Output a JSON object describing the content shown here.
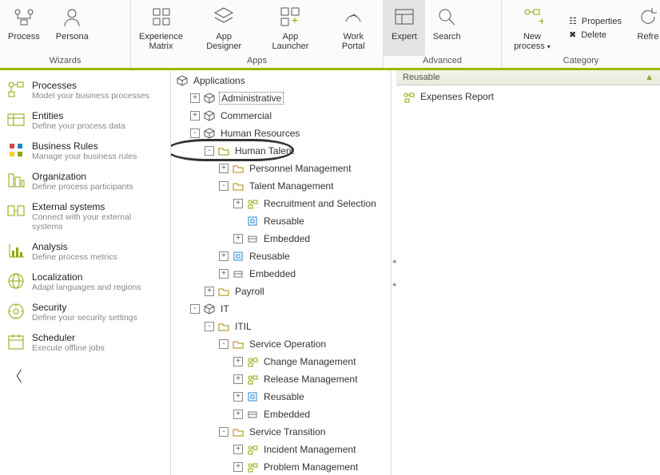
{
  "ribbon": {
    "groups": [
      {
        "label": "Wizards",
        "items": [
          {
            "name": "process",
            "label": "Process"
          },
          {
            "name": "persona",
            "label": "Persona"
          }
        ]
      },
      {
        "label": "Apps",
        "items": [
          {
            "name": "exp-matrix",
            "label": "Experience\nMatrix"
          },
          {
            "name": "app-designer",
            "label": "App Designer"
          },
          {
            "name": "app-launcher",
            "label": "App Launcher"
          },
          {
            "name": "work-portal",
            "label": "Work Portal"
          }
        ]
      },
      {
        "label": "Advanced",
        "items": [
          {
            "name": "expert",
            "label": "Expert",
            "active": true
          },
          {
            "name": "search",
            "label": "Search"
          }
        ]
      },
      {
        "label": "Category",
        "new_label": "New process",
        "small": [
          {
            "name": "properties",
            "label": "Properties"
          },
          {
            "name": "delete",
            "label": "Delete"
          }
        ],
        "refresh": "Refre"
      }
    ]
  },
  "sidebar": [
    {
      "name": "processes",
      "title": "Processes",
      "sub": "Model your business processes"
    },
    {
      "name": "entities",
      "title": "Entities",
      "sub": "Define your process data"
    },
    {
      "name": "business-rules",
      "title": "Business Rules",
      "sub": "Manage your business rules"
    },
    {
      "name": "organization",
      "title": "Organization",
      "sub": "Define process participants"
    },
    {
      "name": "external-systems",
      "title": "External systems",
      "sub": "Connect with your external systems"
    },
    {
      "name": "analysis",
      "title": "Analysis",
      "sub": "Define process metrics"
    },
    {
      "name": "localization",
      "title": "Localization",
      "sub": "Adapt languages and regions"
    },
    {
      "name": "security",
      "title": "Security",
      "sub": "Define your security settings"
    },
    {
      "name": "scheduler",
      "title": "Scheduler",
      "sub": "Execute offline jobs"
    }
  ],
  "tree": {
    "root": "Applications",
    "nodes": [
      {
        "d": 1,
        "exp": "+",
        "icon": "cube",
        "label": "Administrative",
        "sel": true
      },
      {
        "d": 1,
        "exp": "+",
        "icon": "cube",
        "label": "Commercial"
      },
      {
        "d": 1,
        "exp": "-",
        "icon": "cube",
        "label": "Human Resources"
      },
      {
        "d": 2,
        "exp": "-",
        "icon": "folder",
        "label": "Human Talent",
        "circle": true
      },
      {
        "d": 3,
        "exp": "+",
        "icon": "folder",
        "label": "Personnel Management"
      },
      {
        "d": 3,
        "exp": "-",
        "icon": "folder",
        "label": "Talent Management"
      },
      {
        "d": 4,
        "exp": "+",
        "icon": "proc",
        "label": "Recruitment and Selection"
      },
      {
        "d": 4,
        "exp": "",
        "icon": "reuse",
        "label": "Reusable"
      },
      {
        "d": 4,
        "exp": "+",
        "icon": "embed",
        "label": "Embedded"
      },
      {
        "d": 3,
        "exp": "+",
        "icon": "reuse",
        "label": "Reusable"
      },
      {
        "d": 3,
        "exp": "+",
        "icon": "embed",
        "label": "Embedded"
      },
      {
        "d": 2,
        "exp": "+",
        "icon": "folder",
        "label": "Payroll"
      },
      {
        "d": 1,
        "exp": "-",
        "icon": "cube",
        "label": "IT"
      },
      {
        "d": 2,
        "exp": "-",
        "icon": "folder",
        "label": "ITIL"
      },
      {
        "d": 3,
        "exp": "-",
        "icon": "folder",
        "label": "Service Operation"
      },
      {
        "d": 4,
        "exp": "+",
        "icon": "proc",
        "label": "Change Management"
      },
      {
        "d": 4,
        "exp": "+",
        "icon": "proc",
        "label": "Release Management"
      },
      {
        "d": 4,
        "exp": "+",
        "icon": "reuse",
        "label": "Reusable"
      },
      {
        "d": 4,
        "exp": "+",
        "icon": "embed",
        "label": "Embedded"
      },
      {
        "d": 3,
        "exp": "-",
        "icon": "folder",
        "label": "Service Transition"
      },
      {
        "d": 4,
        "exp": "+",
        "icon": "proc",
        "label": "Incident Management"
      },
      {
        "d": 4,
        "exp": "+",
        "icon": "proc",
        "label": "Problem Management"
      }
    ]
  },
  "right": {
    "header": "Reusable",
    "items": [
      {
        "name": "expenses-report",
        "label": "Expenses Report"
      }
    ]
  }
}
